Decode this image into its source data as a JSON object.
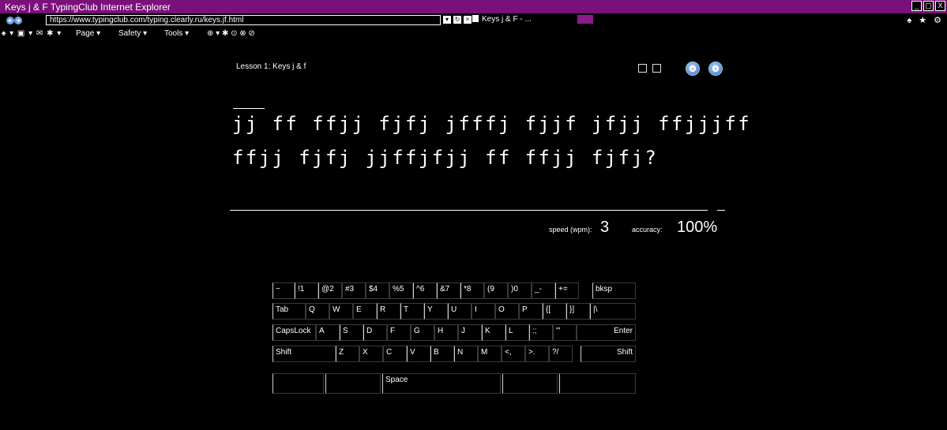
{
  "window": {
    "title": "Keys j & F  TypingClub  Internet Explorer",
    "buttons": [
      "_",
      "▢",
      "X"
    ]
  },
  "address_bar": {
    "url": "https://www.typingclub.com/typing.clearly.ru/keys.jf.html",
    "tab_label": "Keys j & F - ...",
    "right_icons": "♠ ★ ⚙"
  },
  "command_bar": {
    "left_icons": "♠ ▾ ▣ ▾ ✉ ✱ ▾",
    "page": "Page ▾",
    "safety": "Safety ▾",
    "tools": "Tools ▾",
    "extra": "⊕ ▾ ✱ ⊙ ⊗ ⊘"
  },
  "lesson": {
    "title": "Lesson 1: Keys j & f",
    "lines": [
      "jj ff ffjj fjfj jfffj fjjf jfjj ffjjjff",
      "ffjj fjfj jjffjfjj ff ffjj fjfj?"
    ]
  },
  "stats": {
    "speed_label": "speed (wpm):",
    "speed_value": "3",
    "accuracy_label": "accuracy:",
    "accuracy_value": "100%"
  },
  "keyboard": {
    "row1": [
      "~",
      "!1",
      "@2",
      "#3",
      "$4",
      "%5",
      "^6",
      "&7",
      "*8",
      "(9",
      ")0",
      "_-",
      "+=",
      "bksp"
    ],
    "row2": [
      "Tab",
      "Q",
      "W",
      "E",
      "R",
      "T",
      "Y",
      "U",
      "I",
      "O",
      "P",
      "{[",
      "}]",
      "|\\"
    ],
    "row3": [
      "CapsLock",
      "A",
      "S",
      "D",
      "F",
      "G",
      "H",
      "J",
      "K",
      "L",
      ":;",
      "\"'",
      "Enter"
    ],
    "row4": [
      "Shift",
      "Z",
      "X",
      "C",
      "V",
      "B",
      "N",
      "M",
      "<,",
      ">.",
      "?/",
      "Shift"
    ],
    "row5": [
      "",
      "",
      "Space",
      "",
      ""
    ]
  }
}
